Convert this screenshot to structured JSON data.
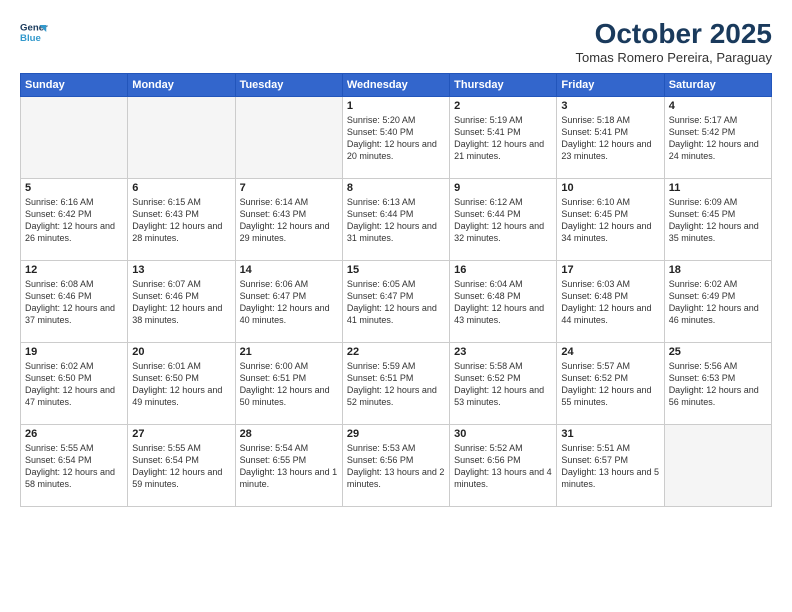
{
  "logo": {
    "line1": "General",
    "line2": "Blue"
  },
  "title": "October 2025",
  "subtitle": "Tomas Romero Pereira, Paraguay",
  "weekdays": [
    "Sunday",
    "Monday",
    "Tuesday",
    "Wednesday",
    "Thursday",
    "Friday",
    "Saturday"
  ],
  "weeks": [
    [
      {
        "day": "",
        "sunrise": "",
        "sunset": "",
        "daylight": ""
      },
      {
        "day": "",
        "sunrise": "",
        "sunset": "",
        "daylight": ""
      },
      {
        "day": "",
        "sunrise": "",
        "sunset": "",
        "daylight": ""
      },
      {
        "day": "1",
        "sunrise": "Sunrise: 5:20 AM",
        "sunset": "Sunset: 5:40 PM",
        "daylight": "Daylight: 12 hours and 20 minutes."
      },
      {
        "day": "2",
        "sunrise": "Sunrise: 5:19 AM",
        "sunset": "Sunset: 5:41 PM",
        "daylight": "Daylight: 12 hours and 21 minutes."
      },
      {
        "day": "3",
        "sunrise": "Sunrise: 5:18 AM",
        "sunset": "Sunset: 5:41 PM",
        "daylight": "Daylight: 12 hours and 23 minutes."
      },
      {
        "day": "4",
        "sunrise": "Sunrise: 5:17 AM",
        "sunset": "Sunset: 5:42 PM",
        "daylight": "Daylight: 12 hours and 24 minutes."
      }
    ],
    [
      {
        "day": "5",
        "sunrise": "Sunrise: 6:16 AM",
        "sunset": "Sunset: 6:42 PM",
        "daylight": "Daylight: 12 hours and 26 minutes."
      },
      {
        "day": "6",
        "sunrise": "Sunrise: 6:15 AM",
        "sunset": "Sunset: 6:43 PM",
        "daylight": "Daylight: 12 hours and 28 minutes."
      },
      {
        "day": "7",
        "sunrise": "Sunrise: 6:14 AM",
        "sunset": "Sunset: 6:43 PM",
        "daylight": "Daylight: 12 hours and 29 minutes."
      },
      {
        "day": "8",
        "sunrise": "Sunrise: 6:13 AM",
        "sunset": "Sunset: 6:44 PM",
        "daylight": "Daylight: 12 hours and 31 minutes."
      },
      {
        "day": "9",
        "sunrise": "Sunrise: 6:12 AM",
        "sunset": "Sunset: 6:44 PM",
        "daylight": "Daylight: 12 hours and 32 minutes."
      },
      {
        "day": "10",
        "sunrise": "Sunrise: 6:10 AM",
        "sunset": "Sunset: 6:45 PM",
        "daylight": "Daylight: 12 hours and 34 minutes."
      },
      {
        "day": "11",
        "sunrise": "Sunrise: 6:09 AM",
        "sunset": "Sunset: 6:45 PM",
        "daylight": "Daylight: 12 hours and 35 minutes."
      }
    ],
    [
      {
        "day": "12",
        "sunrise": "Sunrise: 6:08 AM",
        "sunset": "Sunset: 6:46 PM",
        "daylight": "Daylight: 12 hours and 37 minutes."
      },
      {
        "day": "13",
        "sunrise": "Sunrise: 6:07 AM",
        "sunset": "Sunset: 6:46 PM",
        "daylight": "Daylight: 12 hours and 38 minutes."
      },
      {
        "day": "14",
        "sunrise": "Sunrise: 6:06 AM",
        "sunset": "Sunset: 6:47 PM",
        "daylight": "Daylight: 12 hours and 40 minutes."
      },
      {
        "day": "15",
        "sunrise": "Sunrise: 6:05 AM",
        "sunset": "Sunset: 6:47 PM",
        "daylight": "Daylight: 12 hours and 41 minutes."
      },
      {
        "day": "16",
        "sunrise": "Sunrise: 6:04 AM",
        "sunset": "Sunset: 6:48 PM",
        "daylight": "Daylight: 12 hours and 43 minutes."
      },
      {
        "day": "17",
        "sunrise": "Sunrise: 6:03 AM",
        "sunset": "Sunset: 6:48 PM",
        "daylight": "Daylight: 12 hours and 44 minutes."
      },
      {
        "day": "18",
        "sunrise": "Sunrise: 6:02 AM",
        "sunset": "Sunset: 6:49 PM",
        "daylight": "Daylight: 12 hours and 46 minutes."
      }
    ],
    [
      {
        "day": "19",
        "sunrise": "Sunrise: 6:02 AM",
        "sunset": "Sunset: 6:50 PM",
        "daylight": "Daylight: 12 hours and 47 minutes."
      },
      {
        "day": "20",
        "sunrise": "Sunrise: 6:01 AM",
        "sunset": "Sunset: 6:50 PM",
        "daylight": "Daylight: 12 hours and 49 minutes."
      },
      {
        "day": "21",
        "sunrise": "Sunrise: 6:00 AM",
        "sunset": "Sunset: 6:51 PM",
        "daylight": "Daylight: 12 hours and 50 minutes."
      },
      {
        "day": "22",
        "sunrise": "Sunrise: 5:59 AM",
        "sunset": "Sunset: 6:51 PM",
        "daylight": "Daylight: 12 hours and 52 minutes."
      },
      {
        "day": "23",
        "sunrise": "Sunrise: 5:58 AM",
        "sunset": "Sunset: 6:52 PM",
        "daylight": "Daylight: 12 hours and 53 minutes."
      },
      {
        "day": "24",
        "sunrise": "Sunrise: 5:57 AM",
        "sunset": "Sunset: 6:52 PM",
        "daylight": "Daylight: 12 hours and 55 minutes."
      },
      {
        "day": "25",
        "sunrise": "Sunrise: 5:56 AM",
        "sunset": "Sunset: 6:53 PM",
        "daylight": "Daylight: 12 hours and 56 minutes."
      }
    ],
    [
      {
        "day": "26",
        "sunrise": "Sunrise: 5:55 AM",
        "sunset": "Sunset: 6:54 PM",
        "daylight": "Daylight: 12 hours and 58 minutes."
      },
      {
        "day": "27",
        "sunrise": "Sunrise: 5:55 AM",
        "sunset": "Sunset: 6:54 PM",
        "daylight": "Daylight: 12 hours and 59 minutes."
      },
      {
        "day": "28",
        "sunrise": "Sunrise: 5:54 AM",
        "sunset": "Sunset: 6:55 PM",
        "daylight": "Daylight: 13 hours and 1 minute."
      },
      {
        "day": "29",
        "sunrise": "Sunrise: 5:53 AM",
        "sunset": "Sunset: 6:56 PM",
        "daylight": "Daylight: 13 hours and 2 minutes."
      },
      {
        "day": "30",
        "sunrise": "Sunrise: 5:52 AM",
        "sunset": "Sunset: 6:56 PM",
        "daylight": "Daylight: 13 hours and 4 minutes."
      },
      {
        "day": "31",
        "sunrise": "Sunrise: 5:51 AM",
        "sunset": "Sunset: 6:57 PM",
        "daylight": "Daylight: 13 hours and 5 minutes."
      },
      {
        "day": "",
        "sunrise": "",
        "sunset": "",
        "daylight": ""
      }
    ]
  ]
}
